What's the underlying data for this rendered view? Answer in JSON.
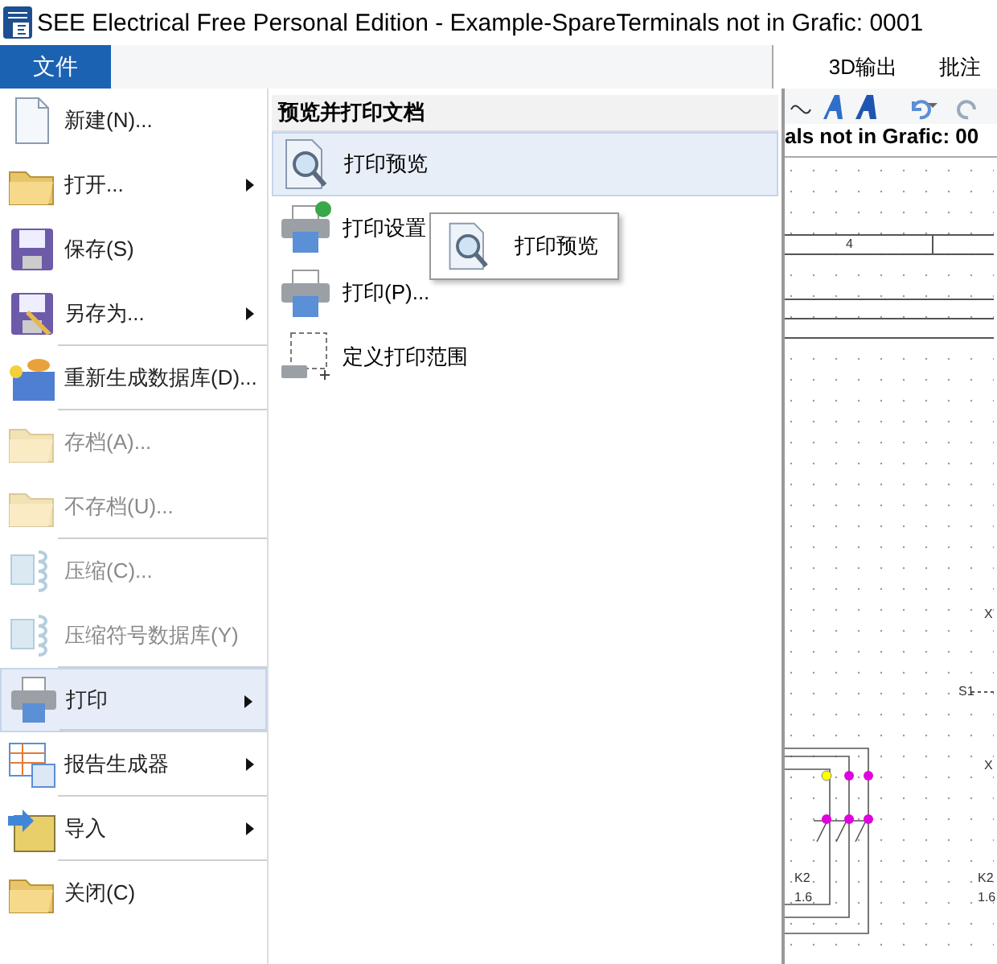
{
  "window": {
    "title": "SEE Electrical Free Personal Edition - Example-SpareTerminals not in Grafic: 0001"
  },
  "ribbon": {
    "file_tab": "文件",
    "tabs": [
      "3D输出",
      "批注"
    ]
  },
  "file_menu": [
    {
      "label": "新建(N)...",
      "disabled": false,
      "selected": false,
      "submenu": false,
      "divider_after": false
    },
    {
      "label": "打开...",
      "disabled": false,
      "selected": false,
      "submenu": true,
      "divider_after": false
    },
    {
      "label": "保存(S)",
      "disabled": false,
      "selected": false,
      "submenu": false,
      "divider_after": false
    },
    {
      "label": "另存为...",
      "disabled": false,
      "selected": false,
      "submenu": true,
      "divider_after": true
    },
    {
      "label": "重新生成数据库(D)...",
      "disabled": false,
      "selected": false,
      "submenu": false,
      "divider_after": true
    },
    {
      "label": "存档(A)...",
      "disabled": true,
      "selected": false,
      "submenu": false,
      "divider_after": false
    },
    {
      "label": "不存档(U)...",
      "disabled": true,
      "selected": false,
      "submenu": false,
      "divider_after": true
    },
    {
      "label": "压缩(C)...",
      "disabled": true,
      "selected": false,
      "submenu": false,
      "divider_after": false
    },
    {
      "label": "压缩符号数据库(Y)",
      "disabled": true,
      "selected": false,
      "submenu": false,
      "divider_after": true
    },
    {
      "label": "打印",
      "disabled": false,
      "selected": true,
      "submenu": true,
      "divider_after": true
    },
    {
      "label": "报告生成器",
      "disabled": false,
      "selected": false,
      "submenu": true,
      "divider_after": true
    },
    {
      "label": "导入",
      "disabled": false,
      "selected": false,
      "submenu": true,
      "divider_after": true
    },
    {
      "label": "关闭(C)",
      "disabled": false,
      "selected": false,
      "submenu": false,
      "divider_after": false
    }
  ],
  "print_panel": {
    "heading": "预览并打印文档",
    "items": [
      {
        "label": "打印预览",
        "selected": true
      },
      {
        "label": "打印设置",
        "selected": false
      },
      {
        "label": "打印(P)...",
        "selected": false
      },
      {
        "label": "定义打印范围",
        "selected": false
      }
    ]
  },
  "tooltip": {
    "label": "打印预览"
  },
  "document": {
    "title": "als not in Grafic: 00",
    "labels": [
      "4",
      "X",
      "S1",
      "X",
      "K2",
      "1.6",
      "K2",
      "1.6"
    ]
  }
}
